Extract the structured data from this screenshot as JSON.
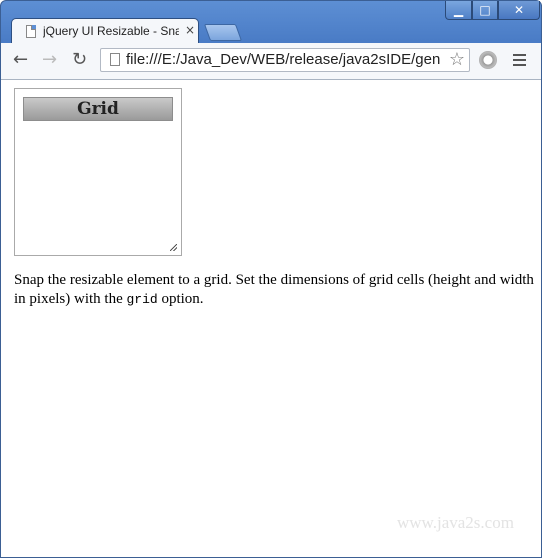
{
  "window": {
    "minimize_label": "▁",
    "maximize_label": "□",
    "close_label": "✕"
  },
  "tab": {
    "title": "jQuery UI Resizable - Snap",
    "close_label": "×"
  },
  "toolbar": {
    "back_label": "←",
    "forward_label": "→",
    "reload_label": "↻",
    "url": "file:///E:/Java_Dev/WEB/release/java2sIDE/gen",
    "star_label": "☆",
    "extension_icon": "stop-icon",
    "menu_icon": "hamburger-icon"
  },
  "page": {
    "resizable_header": "Grid",
    "description_before": "Snap the resizable element to a grid. Set the dimensions of grid cells (height and width in pixels) with the ",
    "description_code": "grid",
    "description_after": " option.",
    "watermark": "www.java2s.com"
  },
  "colors": {
    "frame": "#4a7cc6",
    "toolbar": "#f5f7fa",
    "header_gradient_top": "#c9c9c9",
    "header_gradient_bottom": "#9a9a9a"
  }
}
